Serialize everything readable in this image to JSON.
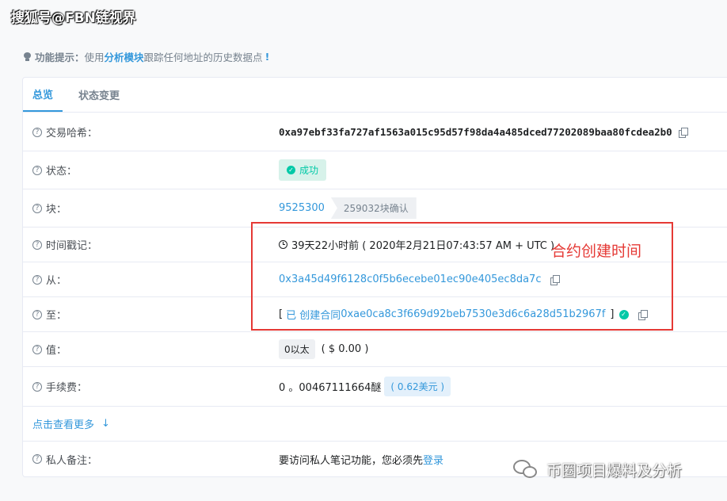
{
  "watermark_top": "搜狐号@FBN链视界",
  "hint": {
    "prefix": "功能提示：",
    "text1": "使用",
    "link": "分析模块",
    "text2": "跟踪任何地址的历史数据点",
    "bang": "!"
  },
  "tabs": [
    {
      "label": "总览",
      "active": true
    },
    {
      "label": "状态变更",
      "active": false
    }
  ],
  "rows": {
    "hash": {
      "label": "交易哈希：",
      "value": "0xa97ebf33fa727af1563a015c95d57f98da4a485dced77202089baa80fcdea2b0"
    },
    "status": {
      "label": "状态：",
      "value": "成功"
    },
    "block": {
      "label": "块：",
      "value": "9525300",
      "confirmations": "259032块确认"
    },
    "timestamp": {
      "label": "时间戳记：",
      "value": "39天22小时前 ( 2020年2月21日07:43:57 AM + UTC )"
    },
    "from": {
      "label": "从：",
      "value": "0x3a45d49f6128c0f5b6ecebe01ec90e405ec8da7c"
    },
    "to": {
      "label": "至：",
      "open": "[",
      "created": "已 创建合同",
      "address": "0xae0ca8c3f669d92beb7530e3d6c6a28d51b2967f",
      "close": "]"
    },
    "value": {
      "label": "值：",
      "amount": "0以太",
      "usd": "( $ 0.00 )"
    },
    "fee": {
      "label": "手续费：",
      "value": "0 。00467111664醚",
      "usd": "( 0.62美元 )"
    },
    "more": {
      "label": "点击查看更多"
    },
    "note": {
      "label": "私人备注：",
      "text": "要访问私人笔记功能，您必须先",
      "link": "登录"
    }
  },
  "annotation": "合约创建时间",
  "watermark_bottom": "币圈项目爆料及分析",
  "colors": {
    "accent": "#3498db",
    "success": "#00c9a7",
    "annotation": "#e53935"
  }
}
